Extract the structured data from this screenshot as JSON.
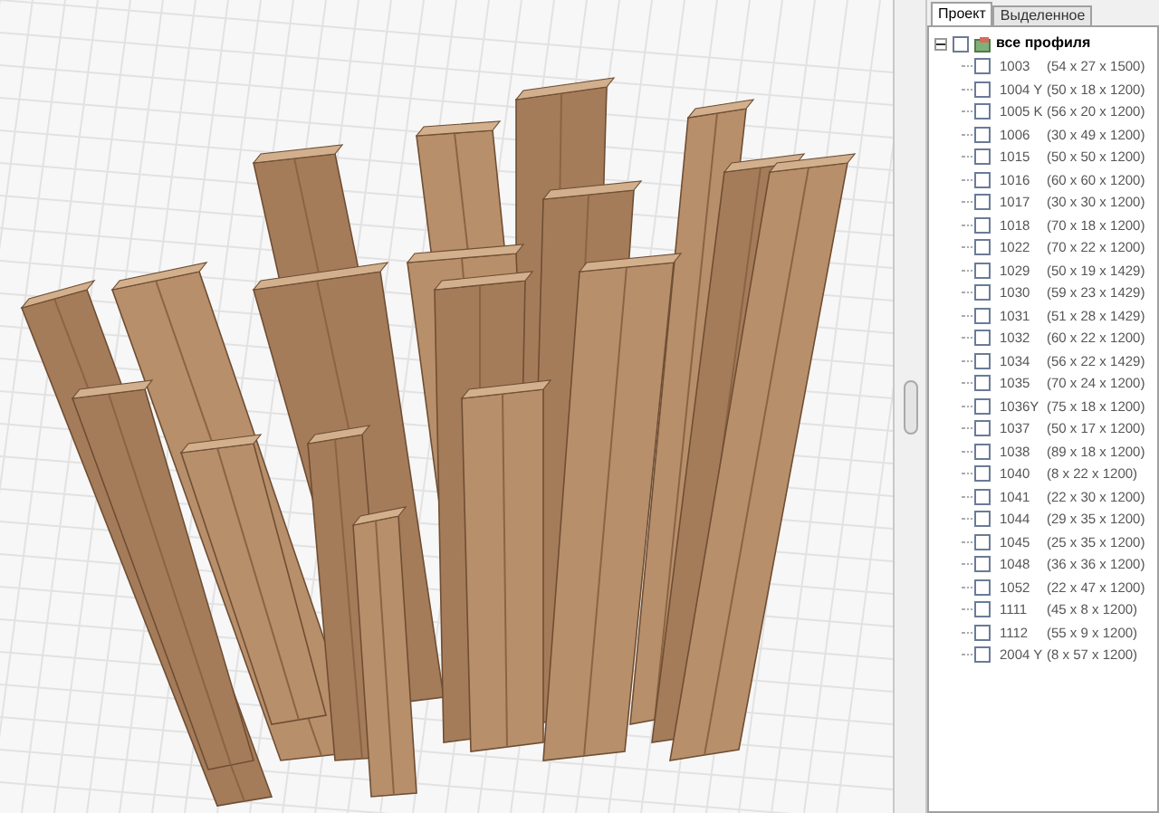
{
  "tabs": [
    {
      "label": "Проект",
      "selected": true
    },
    {
      "label": "Выделенное",
      "selected": false
    }
  ],
  "tree": {
    "label": "все профиля",
    "expanded": true,
    "checked": false,
    "children": [
      {
        "code": "1003",
        "size": "(54 x 27 x 1500)",
        "checked": false
      },
      {
        "code": "1004 Y",
        "size": "(50 x 18 x 1200)",
        "checked": false
      },
      {
        "code": "1005 K",
        "size": "(56 x 20 x 1200)",
        "checked": false
      },
      {
        "code": "1006",
        "size": "(30 x 49 x 1200)",
        "checked": false
      },
      {
        "code": "1015",
        "size": "(50 x 50 x 1200)",
        "checked": false
      },
      {
        "code": "1016",
        "size": "(60 x 60 x 1200)",
        "checked": false
      },
      {
        "code": "1017",
        "size": "(30 x 30 x 1200)",
        "checked": false
      },
      {
        "code": "1018",
        "size": "(70 x 18 x 1200)",
        "checked": false
      },
      {
        "code": "1022",
        "size": "(70 x 22 x 1200)",
        "checked": false
      },
      {
        "code": "1029",
        "size": "(50 x 19 x 1429)",
        "checked": false
      },
      {
        "code": "1030",
        "size": "(59 x 23 x 1429)",
        "checked": false
      },
      {
        "code": "1031",
        "size": "(51 x 28 x 1429)",
        "checked": false
      },
      {
        "code": "1032",
        "size": "(60 x 22 x 1200)",
        "checked": false
      },
      {
        "code": "1034",
        "size": "(56 x 22 x 1429)",
        "checked": false
      },
      {
        "code": "1035",
        "size": "(70 x 24 x 1200)",
        "checked": false
      },
      {
        "code": "1036Y",
        "size": "(75 x 18 x 1200)",
        "checked": false
      },
      {
        "code": "1037",
        "size": "(50 x 17 x 1200)",
        "checked": false
      },
      {
        "code": "1038",
        "size": "(89 x 18 x 1200)",
        "checked": false
      },
      {
        "code": "1040",
        "size": "(8 x 22 x 1200)",
        "checked": false
      },
      {
        "code": "1041",
        "size": "(22 x 30 x 1200)",
        "checked": false
      },
      {
        "code": "1044",
        "size": "(29 x 35 x 1200)",
        "checked": false
      },
      {
        "code": "1045",
        "size": "(25 x 35 x 1200)",
        "checked": false
      },
      {
        "code": "1048",
        "size": "(36 x 36 x 1200)",
        "checked": false
      },
      {
        "code": "1052",
        "size": "(22 x 47 x 1200)",
        "checked": false
      },
      {
        "code": "1111",
        "size": "(45 x 8 x 1200)",
        "checked": false
      },
      {
        "code": "1112",
        "size": "(55 x 9 x 1200)",
        "checked": false
      },
      {
        "code": "2004 Y",
        "size": "(8 x 57 x 1200)",
        "checked": false
      }
    ]
  }
}
